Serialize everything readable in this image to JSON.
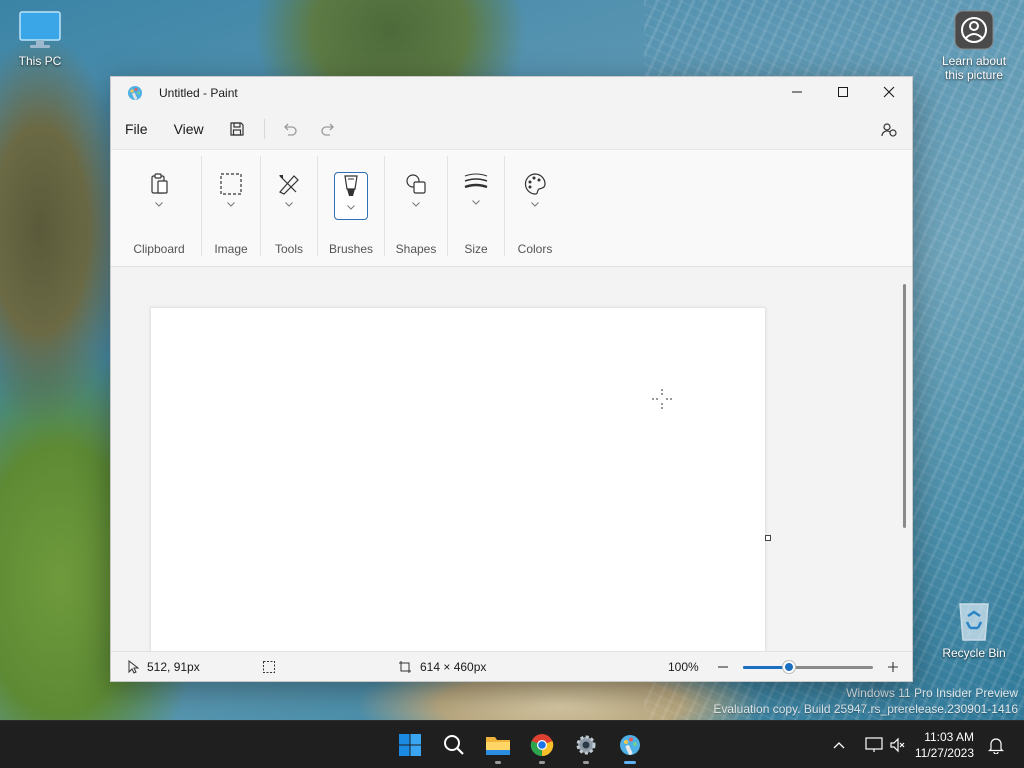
{
  "desktop": {
    "icons": [
      {
        "label": "This PC"
      },
      {
        "label_line1": "Learn about",
        "label_line2": "this picture"
      },
      {
        "label": "Recycle Bin"
      }
    ],
    "watermark_line1": "Windows 11 Pro Insider Preview",
    "watermark_line2": "Evaluation copy. Build 25947.rs_prerelease.230901-1416"
  },
  "window": {
    "title": "Untitled - Paint",
    "menu": {
      "file": "File",
      "view": "View"
    },
    "ribbon": {
      "groups": [
        "Clipboard",
        "Image",
        "Tools",
        "Brushes",
        "Shapes",
        "Size",
        "Colors"
      ]
    },
    "status": {
      "cursor_position": "512, 91px",
      "canvas_size": "614 × 460px",
      "zoom": "100%",
      "zoom_fraction": 0.35
    }
  },
  "taskbar": {
    "time": "11:03 AM",
    "date": "11/27/2023"
  },
  "colors": {
    "accent": "#1a6fc1",
    "taskbar": "#1f1f1f"
  }
}
